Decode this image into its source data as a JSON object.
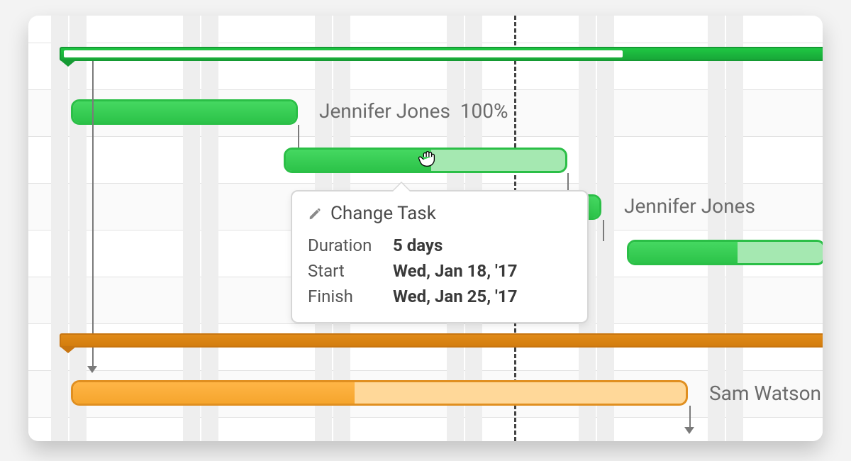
{
  "assignees": {
    "jennifer": "Jennifer Jones",
    "jennifer_completion": "100%",
    "sam": "Sam Watson"
  },
  "tooltip": {
    "title": "Change Task",
    "duration_label": "Duration",
    "duration_value": "5 days",
    "start_label": "Start",
    "start_value": "Wed, Jan 18, '17",
    "finish_label": "Finish",
    "finish_value": "Wed, Jan 25, '17"
  },
  "colors": {
    "green": "#2cc349",
    "orange": "#e08f20"
  }
}
